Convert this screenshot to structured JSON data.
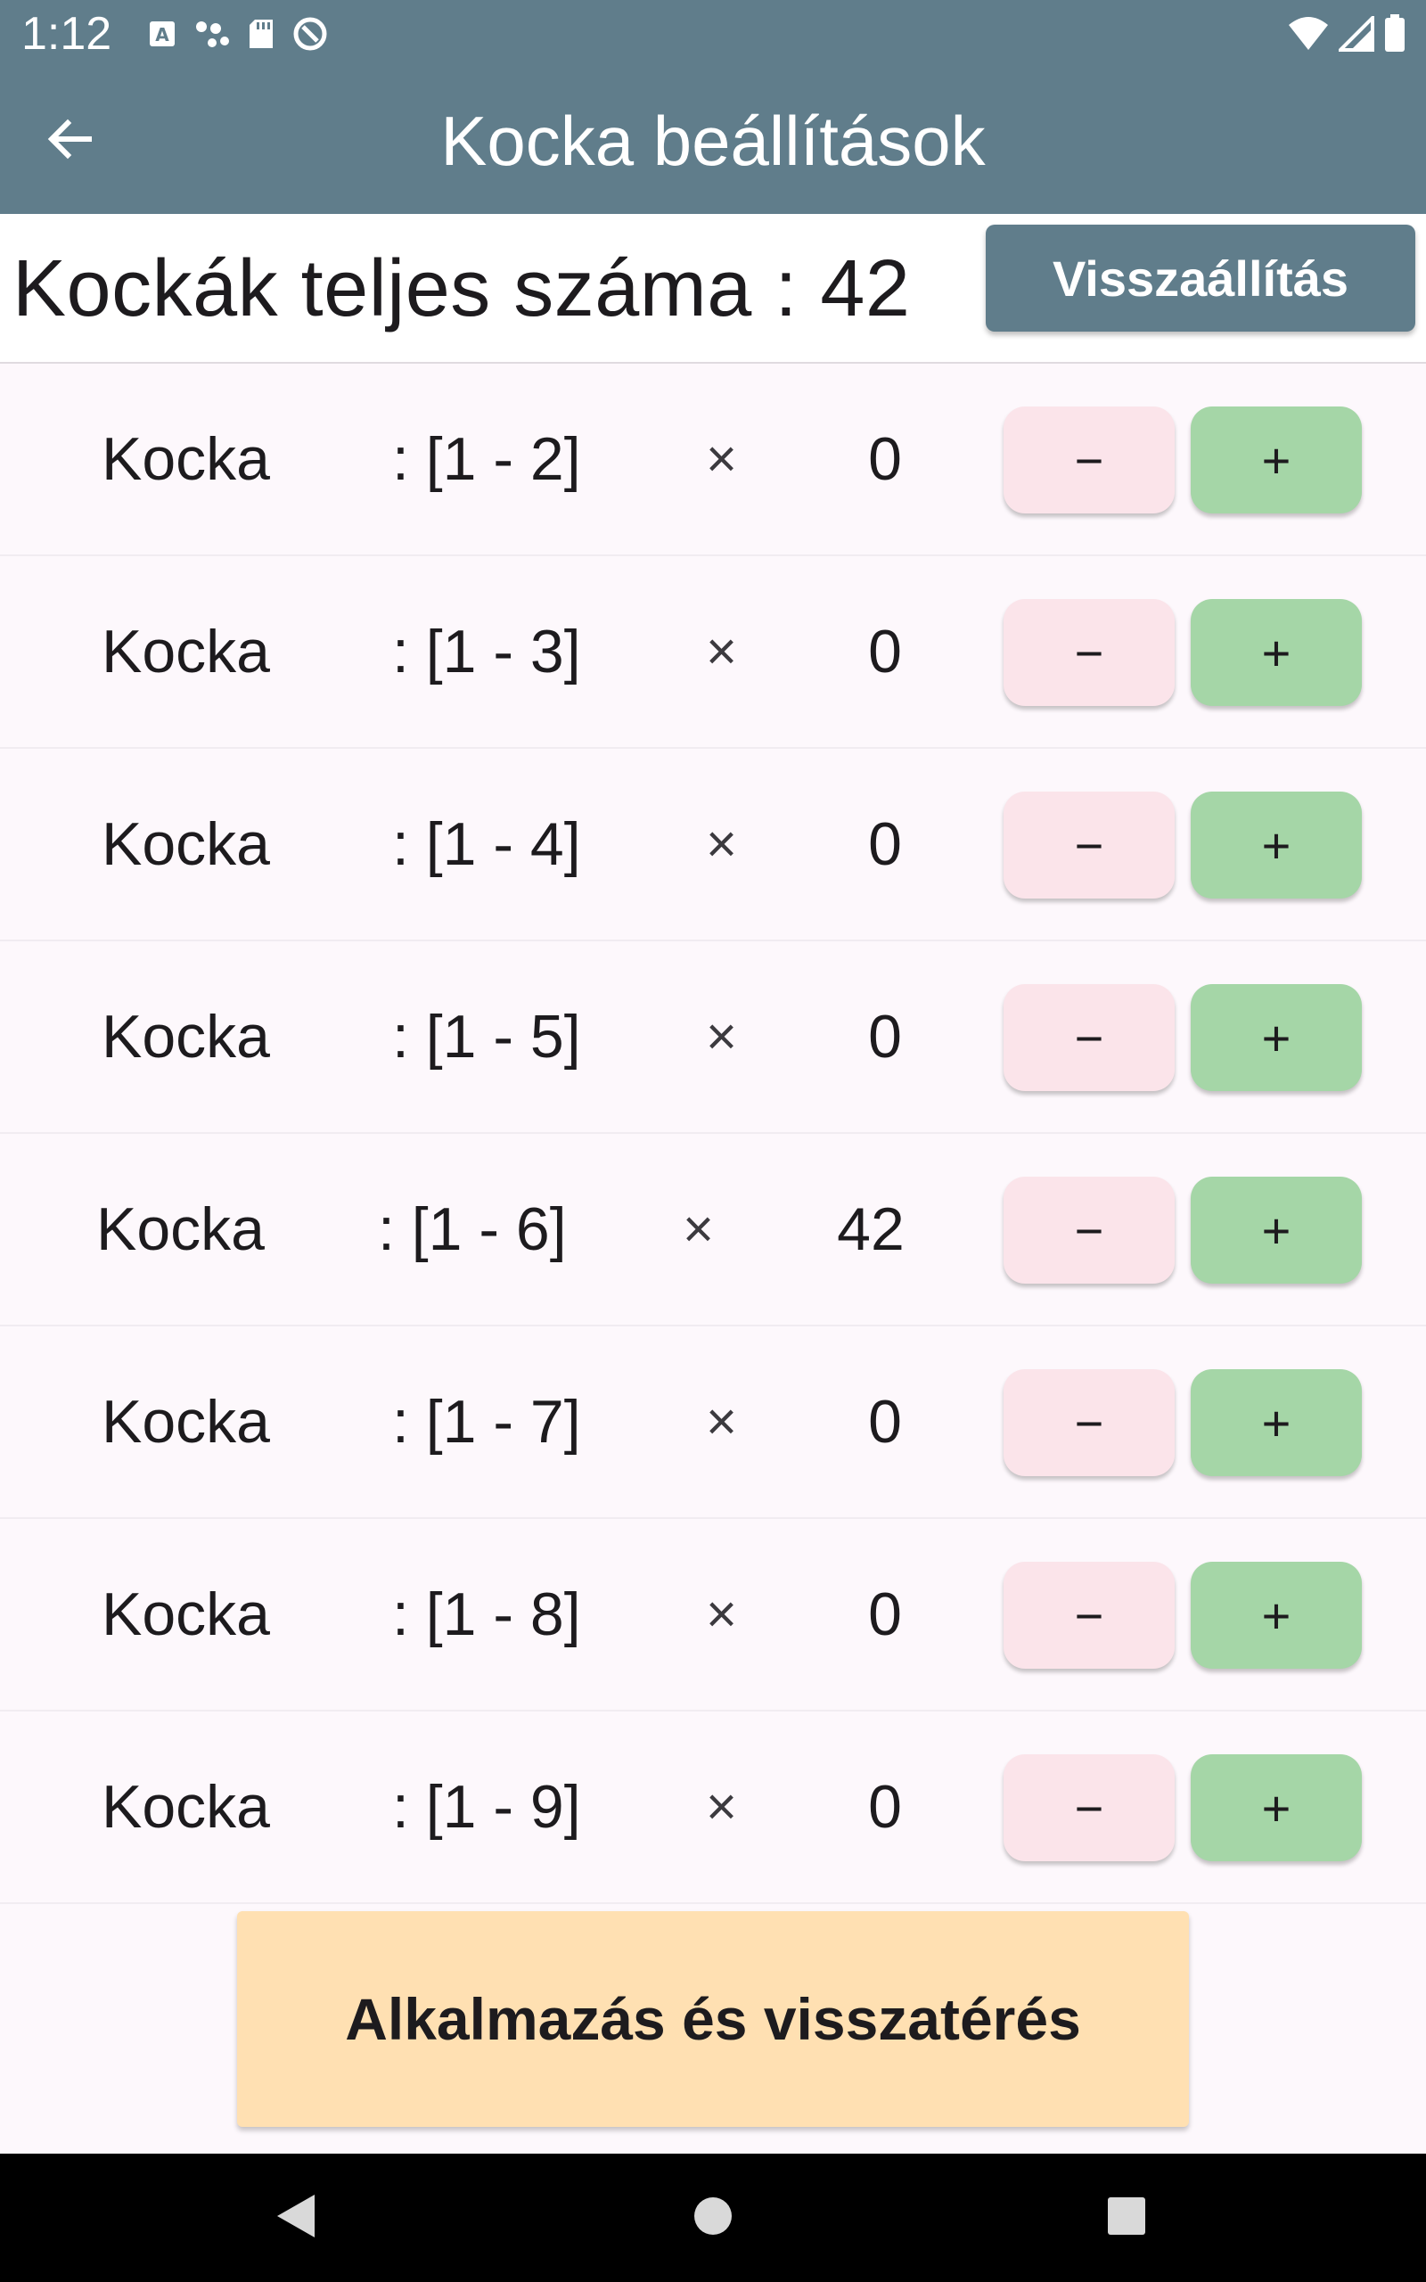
{
  "status_bar": {
    "time": "1:12",
    "left_icons": [
      "keyboard-a-icon",
      "dots-icon",
      "sd-card-icon",
      "sync-blocked-icon"
    ],
    "right_icons": [
      "wifi-icon",
      "signal-icon",
      "battery-icon"
    ]
  },
  "app_bar": {
    "title": "Kocka beállítások",
    "back_icon": "arrow-left-icon"
  },
  "header": {
    "total_label": "Kockák teljes száma : 42",
    "reset_label": "Visszaállítás"
  },
  "dice": [
    {
      "name": "Kocka",
      "range": ": [1 - 2]",
      "times": "×",
      "count": "0",
      "minus": "−",
      "plus": "+"
    },
    {
      "name": "Kocka",
      "range": ": [1 - 3]",
      "times": "×",
      "count": "0",
      "minus": "−",
      "plus": "+"
    },
    {
      "name": "Kocka",
      "range": ": [1 - 4]",
      "times": "×",
      "count": "0",
      "minus": "−",
      "plus": "+"
    },
    {
      "name": "Kocka",
      "range": ": [1 - 5]",
      "times": "×",
      "count": "0",
      "minus": "−",
      "plus": "+"
    },
    {
      "name": "Kocka",
      "range": ": [1 - 6]",
      "times": "×",
      "count": "42",
      "minus": "−",
      "plus": "+"
    },
    {
      "name": "Kocka",
      "range": ": [1 - 7]",
      "times": "×",
      "count": "0",
      "minus": "−",
      "plus": "+"
    },
    {
      "name": "Kocka",
      "range": ": [1 - 8]",
      "times": "×",
      "count": "0",
      "minus": "−",
      "plus": "+"
    },
    {
      "name": "Kocka",
      "range": ": [1 - 9]",
      "times": "×",
      "count": "0",
      "minus": "−",
      "plus": "+"
    }
  ],
  "apply_label": "Alkalmazás és visszatérés",
  "nav_bar": {
    "icons": [
      "nav-back-icon",
      "nav-home-icon",
      "nav-recents-icon"
    ]
  },
  "colors": {
    "app_bar": "#607d8b",
    "background": "#fdf8fc",
    "minus_button": "#fbe4ea",
    "plus_button": "#a5d6a7",
    "apply_button": "#ffe0b2"
  }
}
